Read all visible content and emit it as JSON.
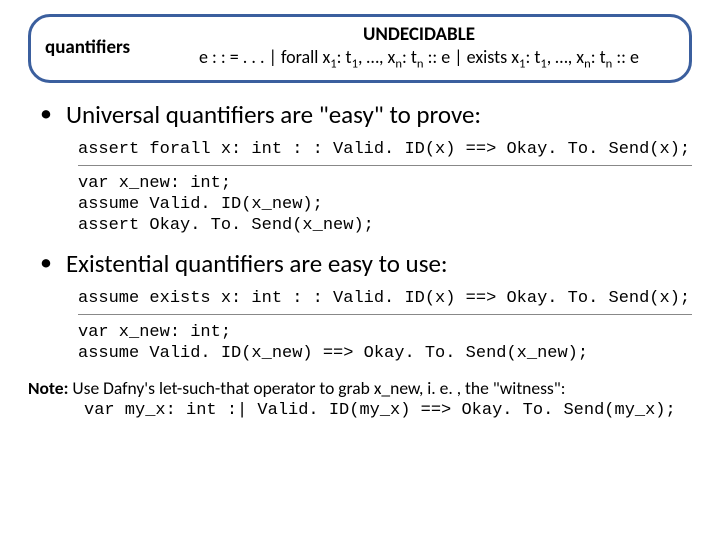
{
  "header": {
    "label": "quantifiers",
    "undecidable": "UNDECIDABLE",
    "grammar_html": "e : : = . . . | forall x<sub>1</sub>: t<sub>1</sub>, …, x<sub>n</sub>: t<sub>n</sub> :: e | exists x<sub>1</sub>: t<sub>1</sub>, …, x<sub>n</sub>: t<sub>n</sub> :: e"
  },
  "bullets": [
    "Universal quantifiers are \"easy\" to prove:",
    "Existential quantifiers are easy to use:"
  ],
  "code": {
    "forall_assert": "assert forall x: int : : Valid. ID(x) ==> Okay. To. Send(x);",
    "forall_expand": "var x_new: int;\nassume Valid. ID(x_new);\nassert Okay. To. Send(x_new);",
    "exists_assume": "assume exists x: int : : Valid. ID(x) ==> Okay. To. Send(x);",
    "exists_expand": "var x_new: int;\nassume Valid. ID(x_new) ==> Okay. To. Send(x_new);"
  },
  "note": {
    "lead": "Note:",
    "text": " Use Dafny's let-such-that operator to grab x_new, i. e. , the \"witness\":",
    "code": "var my_x: int :| Valid. ID(my_x) ==> Okay. To. Send(my_x);"
  }
}
